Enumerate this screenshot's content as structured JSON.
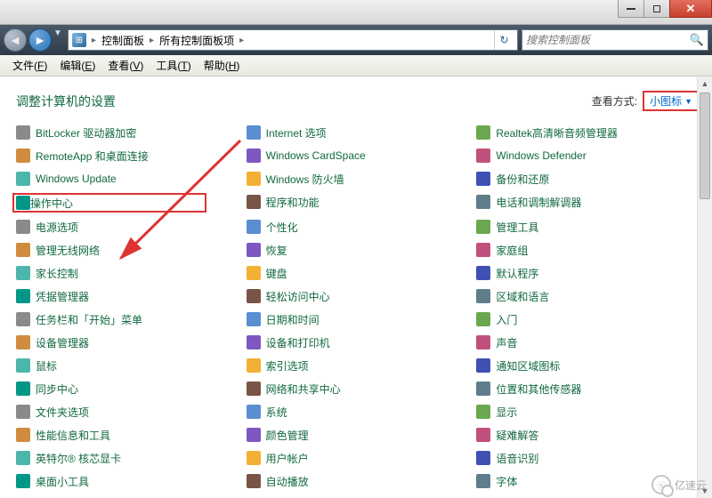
{
  "breadcrumb": {
    "cp": "控制面板",
    "all": "所有控制面板项"
  },
  "search": {
    "placeholder": "搜索控制面板"
  },
  "menus": [
    {
      "t": "文件",
      "k": "F"
    },
    {
      "t": "编辑",
      "k": "E"
    },
    {
      "t": "查看",
      "k": "V"
    },
    {
      "t": "工具",
      "k": "T"
    },
    {
      "t": "帮助",
      "k": "H"
    }
  ],
  "page_title": "调整计算机的设置",
  "view_by": {
    "label": "查看方式:",
    "value": "小图标"
  },
  "items_col1": [
    "BitLocker 驱动器加密",
    "RemoteApp 和桌面连接",
    "Windows Update",
    "操作中心",
    "电源选项",
    "管理无线网络",
    "家长控制",
    "凭据管理器",
    "任务栏和「开始」菜单",
    "设备管理器",
    "鼠标",
    "同步中心",
    "文件夹选项",
    "性能信息和工具",
    "英特尔® 核芯显卡",
    "桌面小工具"
  ],
  "items_col2": [
    "Internet 选项",
    "Windows CardSpace",
    "Windows 防火墙",
    "程序和功能",
    "个性化",
    "恢复",
    "键盘",
    "轻松访问中心",
    "日期和时间",
    "设备和打印机",
    "索引选项",
    "网络和共享中心",
    "系统",
    "颜色管理",
    "用户帐户",
    "自动播放"
  ],
  "items_col3": [
    "Realtek高清晰音频管理器",
    "Windows Defender",
    "备份和还原",
    "电话和调制解调器",
    "管理工具",
    "家庭组",
    "默认程序",
    "区域和语言",
    "入门",
    "声音",
    "通知区域图标",
    "位置和其他传感器",
    "显示",
    "疑难解答",
    "语音识别",
    "字体"
  ],
  "highlight_index_col1": 3,
  "watermark": "亿速云"
}
